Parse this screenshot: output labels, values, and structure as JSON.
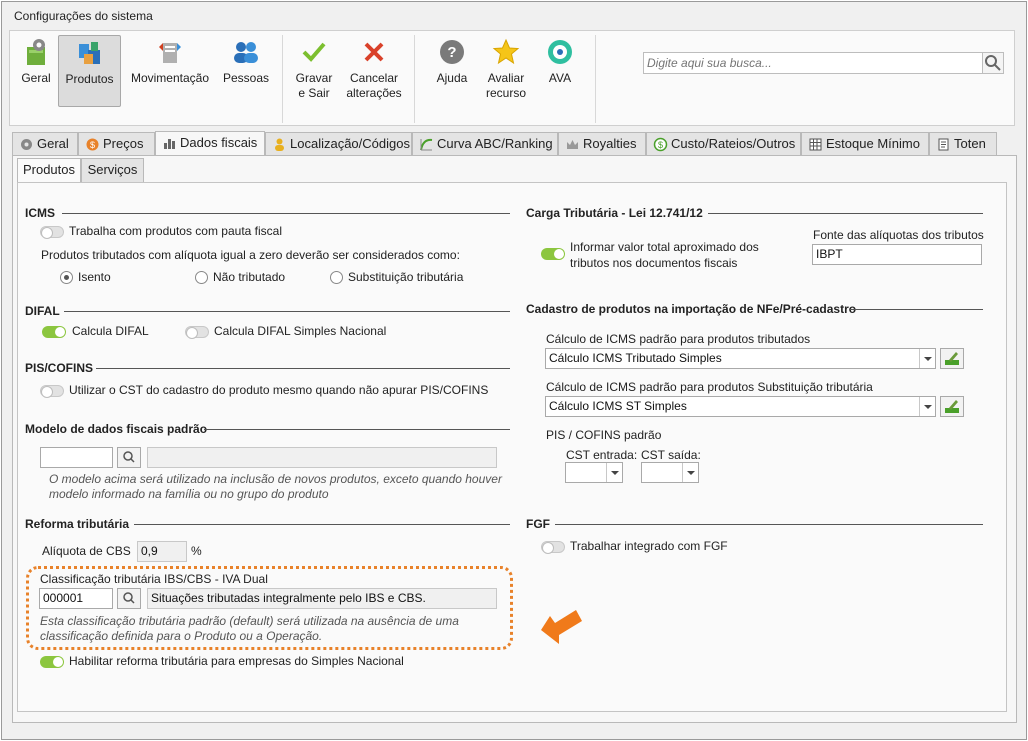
{
  "window": {
    "title": "Configurações do sistema"
  },
  "ribbon": {
    "geral": "Geral",
    "produtos": "Produtos",
    "movimentacao": "Movimentação",
    "pessoas": "Pessoas",
    "gravar": [
      "Gravar",
      "e Sair"
    ],
    "cancelar": [
      "Cancelar",
      "alterações"
    ],
    "ajuda": "Ajuda",
    "avaliar": [
      "Avaliar",
      "recurso"
    ],
    "ava": "AVA",
    "search_placeholder": "Digite aqui sua busca..."
  },
  "tabs": [
    "Geral",
    "Preços",
    "Dados fiscais",
    "Localização/Códigos",
    "Curva ABC/Ranking",
    "Royalties",
    "Custo/Rateios/Outros",
    "Estoque Mínimo",
    "Toten"
  ],
  "subtabs": [
    "Produtos",
    "Serviços"
  ],
  "icms": {
    "title": "ICMS",
    "pauta": "Trabalha com produtos com pauta fiscal",
    "aliquota_zero": "Produtos tributados com alíquota igual a zero deverão ser considerados como:",
    "options": [
      "Isento",
      "Não tributado",
      "Substituição tributária"
    ]
  },
  "difal": {
    "title": "DIFAL",
    "calcula": "Calcula DIFAL",
    "simples": "Calcula DIFAL Simples Nacional"
  },
  "pis": {
    "title": "PIS/COFINS",
    "cst": "Utilizar o CST do cadastro do produto mesmo quando não apurar PIS/COFINS"
  },
  "modelo": {
    "title": "Modelo de dados fiscais padrão",
    "note": [
      "O modelo acima será utilizado na inclusão de novos produtos, exceto quando houver",
      "modelo informado na família ou no grupo do produto"
    ]
  },
  "reforma": {
    "title": "Reforma tributária",
    "aliquota_label": "Alíquota de CBS",
    "aliquota_value": "0,9",
    "percent": "%",
    "class_title": "Classificação tributária IBS/CBS - IVA Dual",
    "class_code": "000001",
    "class_desc": "Situações tributadas integralmente pelo IBS e CBS.",
    "class_note": [
      "Esta classificação tributária padrão (default) será utilizada na ausência de uma",
      "classificação definida para o Produto ou a Operação."
    ],
    "habilitar": "Habilitar reforma tributária para empresas do Simples Nacional"
  },
  "carga": {
    "title": "Carga Tributária - Lei 12.741/12",
    "informar": [
      "Informar valor total aproximado dos",
      "tributos nos documentos fiscais"
    ],
    "fonte_label": "Fonte das alíquotas dos tributos",
    "fonte_value": "IBPT"
  },
  "cadastro": {
    "title": "Cadastro de produtos na importação de NFe/Pré-cadastro",
    "icms_trib_label": "Cálculo de ICMS padrão para produtos tributados",
    "icms_trib_value": "Cálculo ICMS Tributado Simples",
    "icms_st_label": "Cálculo de ICMS padrão para produtos Substituição tributária",
    "icms_st_value": "Cálculo ICMS ST Simples",
    "pis_label": "PIS / COFINS padrão",
    "cst_entrada": "CST entrada:",
    "cst_saida": "CST saída:"
  },
  "fgf": {
    "title": "FGF",
    "integrado": "Trabalhar integrado com FGF"
  },
  "colors": {
    "accent_green": "#8cc63f",
    "highlight_orange": "#e8822a"
  }
}
